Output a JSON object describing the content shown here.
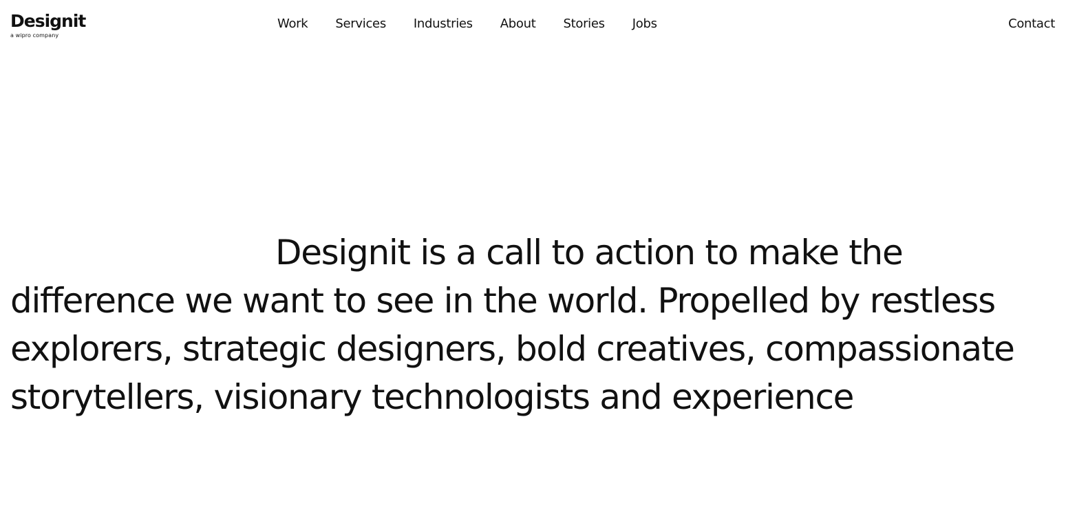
{
  "logo": {
    "name": "Designit",
    "tagline": "a wipro company"
  },
  "nav": {
    "items": [
      {
        "label": "Work"
      },
      {
        "label": "Services"
      },
      {
        "label": "Industries"
      },
      {
        "label": "About"
      },
      {
        "label": "Stories"
      },
      {
        "label": "Jobs"
      }
    ],
    "contact": "Contact"
  },
  "hero": {
    "text": "Designit is a call to action to make the difference we want to see in the world. Propelled by restless explorers, strategic designers, bold creatives, compassionate storytellers, visionary technologists and experience"
  },
  "colors": {
    "background": "#ffffff",
    "text": "#111111"
  }
}
